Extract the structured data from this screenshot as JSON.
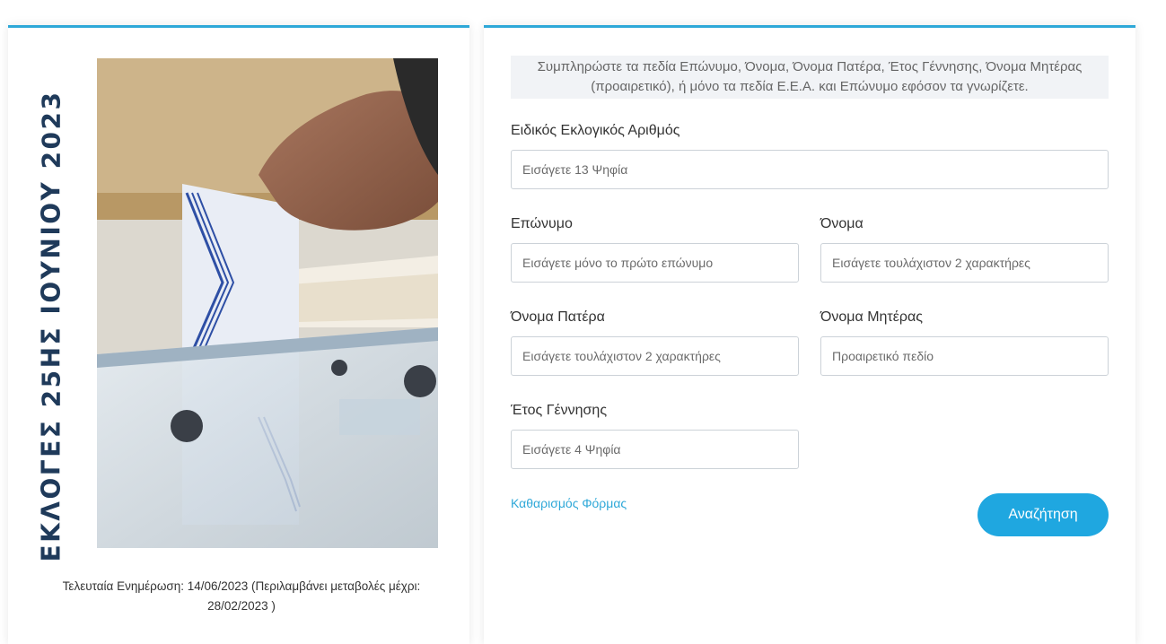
{
  "sidebar": {
    "vertical_title": "ΕΚΛΟΓΕΣ 25ΗΣ ΙΟΥΝΙΟΥ 2023",
    "update_note": "Τελευταία Ενημέρωση: 14/06/2023 (Περιλαμβάνει μεταβολές μέχρι: 28/02/2023 )"
  },
  "form": {
    "info_text": "Συμπληρώστε τα πεδία Επώνυμο, Όνομα, Όνομα Πατέρα, Έτος Γέννησης, Όνομα Μητέρας (προαιρετικό), ή μόνο τα πεδία Ε.Ε.Α. και Επώνυμο εφόσον τα γνωρίζετε.",
    "special_number": {
      "label": "Ειδικός Εκλογικός Αριθμός",
      "placeholder": "Εισάγετε 13 Ψηφία",
      "value": ""
    },
    "surname": {
      "label": "Επώνυμο",
      "placeholder": "Εισάγετε μόνο το πρώτο επώνυμο",
      "value": ""
    },
    "first_name": {
      "label": "Όνομα",
      "placeholder": "Εισάγετε τουλάχιστον 2 χαρακτήρες",
      "value": ""
    },
    "father_name": {
      "label": "Όνομα Πατέρα",
      "placeholder": "Εισάγετε τουλάχιστον 2 χαρακτήρες",
      "value": ""
    },
    "mother_name": {
      "label": "Όνομα Μητέρας",
      "placeholder": "Προαιρετικό πεδίο",
      "value": ""
    },
    "birth_year": {
      "label": "Έτος Γέννησης",
      "placeholder": "Εισάγετε 4 Ψηφία",
      "value": ""
    },
    "clear_label": "Καθαρισμός Φόρμας",
    "search_label": "Αναζήτηση"
  },
  "colors": {
    "accent": "#2ea8d8",
    "button": "#1fa7e0",
    "title": "#1f3a5a",
    "info_bg": "#f1f3f6"
  }
}
